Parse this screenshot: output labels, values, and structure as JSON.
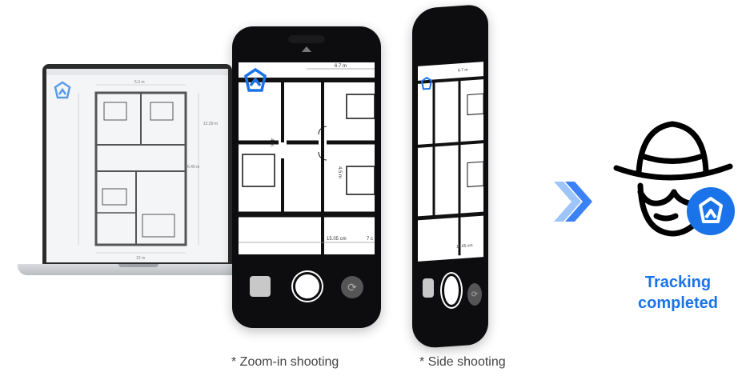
{
  "laptop": {
    "plan_dimensions": [
      "5.3 m",
      "6.45 m",
      "12.59 m",
      "12 m"
    ]
  },
  "phone_zoom": {
    "plan_labels": [
      "6.7 m",
      "4 m",
      "4.5 m",
      "15.05 cm",
      "7 c"
    ]
  },
  "phone_side": {
    "plan_labels": [
      "6.7 m",
      "15.05 cm"
    ]
  },
  "result": {
    "status_text": "Tracking completed"
  },
  "captions": {
    "zoom_in": "* Zoom-in shooting",
    "side": "* Side shooting"
  },
  "colors": {
    "accent": "#1a73e8",
    "badge": "#1a73e8",
    "arrow": "#3b82f6"
  }
}
